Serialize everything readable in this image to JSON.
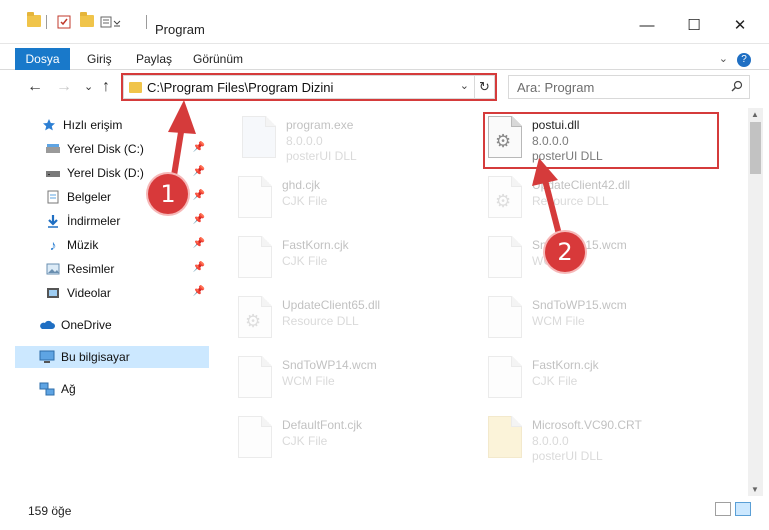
{
  "window": {
    "title": "Program",
    "minimize": "—",
    "maximize": "☐",
    "close": "✕"
  },
  "ribbon": {
    "tabs": [
      "Dosya",
      "Giriş",
      "Paylaş",
      "Görünüm"
    ],
    "help": "?"
  },
  "nav": {
    "back": "←",
    "forward": "→",
    "recent": "⌄",
    "up": "↑",
    "address": "C:\\Program Files\\Program Dizini",
    "refresh": "↻",
    "search_placeholder": "Ara: Program"
  },
  "sidebar": {
    "quick_access": "Hızlı erişim",
    "items": [
      {
        "label": "Yerel Disk (C:)",
        "icon": "drive-icon"
      },
      {
        "label": "Yerel Disk (D:)",
        "icon": "drive-icon"
      },
      {
        "label": "Belgeler",
        "icon": "documents-icon"
      },
      {
        "label": "İndirmeler",
        "icon": "downloads-icon"
      },
      {
        "label": "Müzik",
        "icon": "music-icon"
      },
      {
        "label": "Resimler",
        "icon": "pictures-icon"
      },
      {
        "label": "Videolar",
        "icon": "videos-icon"
      }
    ],
    "onedrive": "OneDrive",
    "this_pc": "Bu bilgisayar",
    "network": "Ağ"
  },
  "files": [
    {
      "name": "program.exe",
      "line1": "8.0.0.0",
      "line2": "posterUI DLL",
      "faded": true
    },
    {
      "name": "postui.dll",
      "line1": "8.0.0.0",
      "line2": "posterUI DLL",
      "faded": false
    },
    {
      "name": "ghd.cjk",
      "line1": "CJK File",
      "line2": "",
      "faded": true
    },
    {
      "name": "UpdateClient42.dll",
      "line1": "Resource DLL",
      "line2": "",
      "faded": true
    },
    {
      "name": "FastKorn.cjk",
      "line1": "CJK File",
      "line2": "",
      "faded": true
    },
    {
      "name": "SndToWP15.wcm",
      "line1": "WCM File",
      "line2": "",
      "faded": true
    },
    {
      "name": "UpdateClient65.dll",
      "line1": "Resource DLL",
      "line2": "",
      "faded": true
    },
    {
      "name": "SndToWP15.wcm",
      "line1": "WCM File",
      "line2": "",
      "faded": true
    },
    {
      "name": "SndToWP14.wcm",
      "line1": "WCM File",
      "line2": "",
      "faded": true
    },
    {
      "name": "FastKorn.cjk",
      "line1": "CJK File",
      "line2": "",
      "faded": true
    },
    {
      "name": "DefaultFont.cjk",
      "line1": "CJK File",
      "line2": "",
      "faded": true
    },
    {
      "name": "Microsoft.VC90.CRT",
      "line1": "8.0.0.0",
      "line2": "posterUI DLL",
      "faded": true
    }
  ],
  "status": {
    "count": "159 öğe"
  },
  "annotations": {
    "badge1": "1",
    "badge2": "2",
    "color": "#d53b3b"
  }
}
